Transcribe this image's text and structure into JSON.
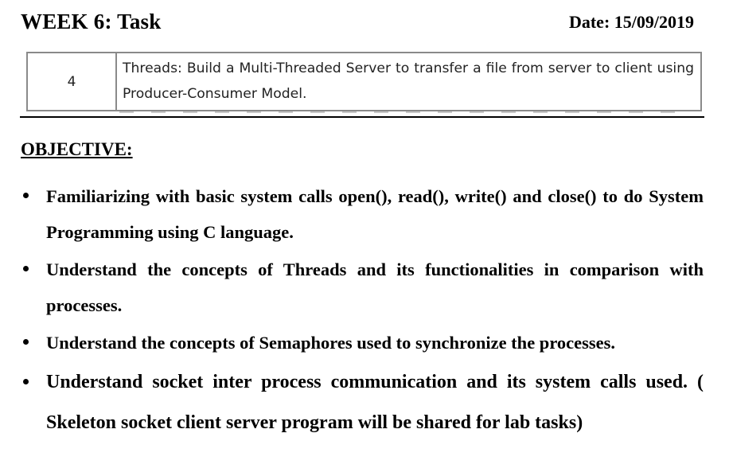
{
  "header": {
    "title": "WEEK 6: Task",
    "date": "Date: 15/09/2019"
  },
  "task_table": {
    "number": "4",
    "description": "Threads: Build a Multi-Threaded Server to transfer a file from server to client using Producer-Consumer Model."
  },
  "objective": {
    "heading": "OBJECTIVE:",
    "items": [
      "Familiarizing with basic system calls open(), read(), write() and close() to do System Programming using C language.",
      "Understand the concepts of Threads and its functionalities in comparison with processes.",
      "Understand the concepts of Semaphores used to synchronize the processes.",
      "Understand socket inter process communication and its system calls used. ( Skeleton socket client server program will be shared for lab tasks)"
    ]
  }
}
